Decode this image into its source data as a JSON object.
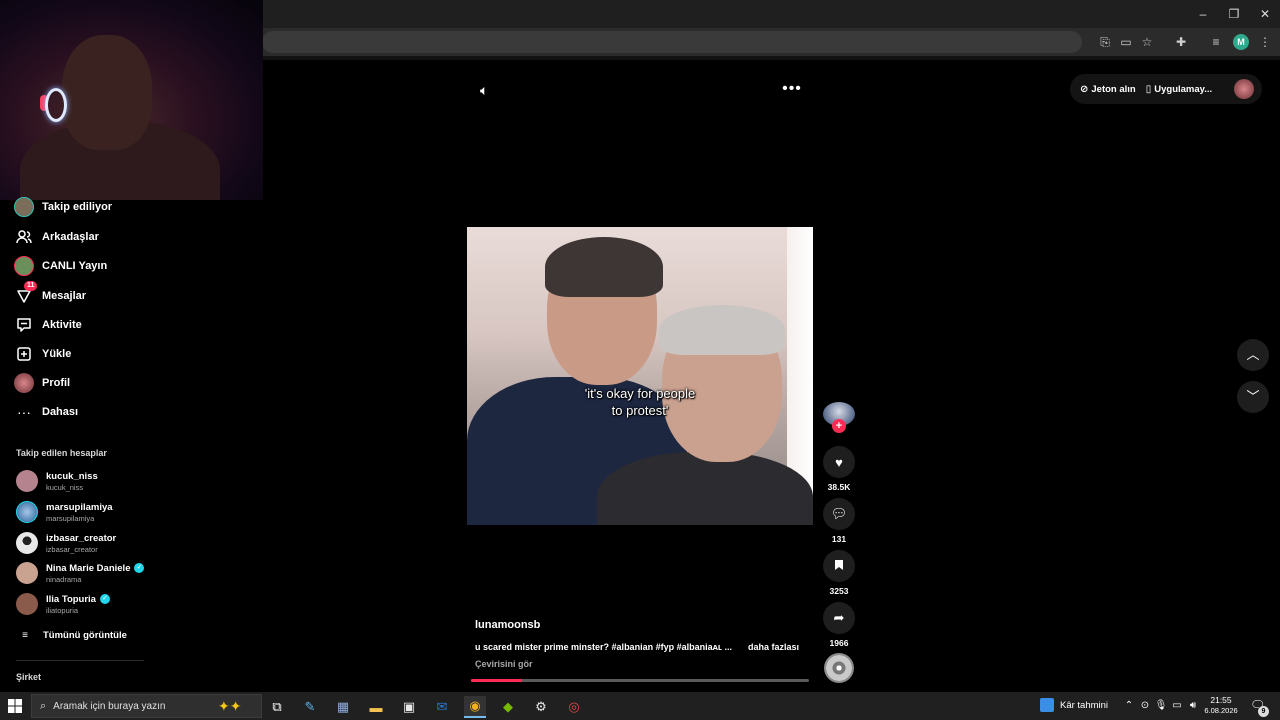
{
  "browser": {
    "window_controls": {
      "minimize": "–",
      "restore": "❐",
      "close": "✕"
    },
    "profile_initial": "M",
    "toolbar_icons": [
      "translate-icon",
      "cast-icon",
      "star-icon",
      "extensions-icon",
      "media-icon",
      "menu-icon"
    ]
  },
  "top_controls": {
    "coins_label": "Jeton alın",
    "app_label": "Uygulamay..."
  },
  "sidebar": {
    "nav": [
      {
        "label": "Takip ediliyor",
        "icon": "following-avatar-icon"
      },
      {
        "label": "Arkadaşlar",
        "icon": "friends-icon"
      },
      {
        "label": "CANLI Yayın",
        "icon": "live-icon"
      },
      {
        "label": "Mesajlar",
        "icon": "messages-icon",
        "badge": "11"
      },
      {
        "label": "Aktivite",
        "icon": "activity-icon"
      },
      {
        "label": "Yükle",
        "icon": "upload-icon"
      },
      {
        "label": "Profil",
        "icon": "profile-icon"
      },
      {
        "label": "Dahası",
        "icon": "more-icon"
      }
    ],
    "following_title": "Takip edilen hesaplar",
    "accounts": [
      {
        "name": "kucuk_niss",
        "handle": "kucuk_niss",
        "verified": false,
        "color": "#b5838d"
      },
      {
        "name": "marsupilamiya",
        "handle": "marsupilamiya",
        "verified": false,
        "color": "#4a7fb0"
      },
      {
        "name": "izbasar_creator",
        "handle": "izbasar_creator",
        "verified": false,
        "color": "#e8e8e8"
      },
      {
        "name": "Nina Marie Daniele",
        "handle": "ninadrama",
        "verified": true,
        "color": "#c9a38f"
      },
      {
        "name": "Ilia Topuria",
        "handle": "iliatopuria",
        "verified": true,
        "color": "#8a5a4a"
      }
    ],
    "see_all": "Tümünü görüntüle",
    "company_title": "Şirket"
  },
  "video": {
    "caption_line1": "'it's okay for people",
    "caption_line2": "to protest'",
    "progress_percent": 15
  },
  "actions": {
    "likes": "38.5K",
    "comments": "131",
    "saves": "3253",
    "shares": "1966"
  },
  "post": {
    "author": "lunamoonsb",
    "description": "u scared mister prime minster? #albanian #fyp #albaniaᴀʟ ...",
    "more_label": "daha fazlası",
    "translate_label": "Çevirisini gör"
  },
  "taskbar": {
    "search_placeholder": "Aramak için buraya yazın",
    "weather_label": "Kâr tahmini",
    "time": "21:55",
    "date": "6.08.2026",
    "notification_count": "9"
  }
}
